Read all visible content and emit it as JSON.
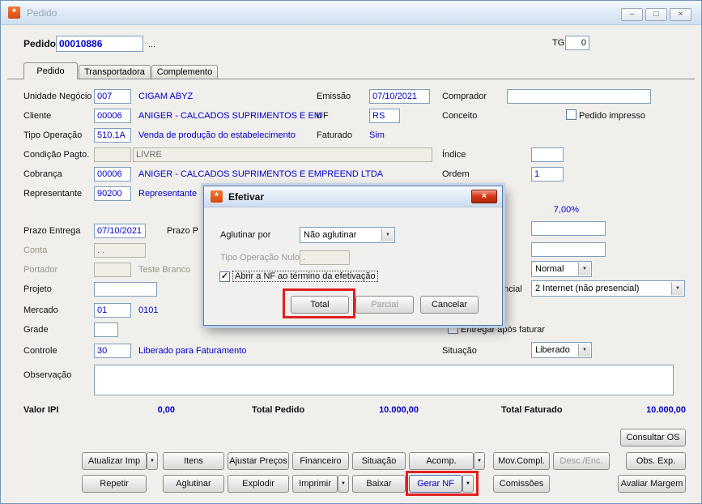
{
  "window": {
    "title": "Pedido"
  },
  "icons": {
    "app": "*",
    "close": "×",
    "minimize": "–",
    "maximize": "□",
    "dropdown": "▼",
    "check": "✓"
  },
  "header": {
    "pedido_label": "Pedido",
    "pedido_value": "00010886",
    "more_button": "...",
    "tg_label": "TG",
    "tg_value": "0"
  },
  "tabs": {
    "pedido": "Pedido",
    "transportadora": "Transportadora",
    "complemento": "Complemento"
  },
  "form": {
    "unidade_negocio": {
      "label": "Unidade Negócio",
      "code": "007",
      "desc": "CIGAM ABYZ"
    },
    "emissao": {
      "label": "Emissão",
      "value": "07/10/2021"
    },
    "comprador": {
      "label": "Comprador",
      "value": ""
    },
    "cliente": {
      "label": "Cliente",
      "code": "00006",
      "desc": "ANIGER - CALCADOS SUPRIMENTOS E EM"
    },
    "uf": {
      "label": "UF",
      "value": "RS"
    },
    "conceito": {
      "label": "Conceito"
    },
    "pedido_impresso": {
      "label": "Pedido impresso",
      "checked": false
    },
    "tipo_operacao": {
      "label": "Tipo Operação",
      "code": "510.1A",
      "desc": "Venda de produção do estabelecimento"
    },
    "faturado": {
      "label": "Faturado",
      "value": "Sim"
    },
    "condicao_pagto": {
      "label": "Condição Pagto.",
      "code": "",
      "value": "LIVRE"
    },
    "indice": {
      "label": "Índice",
      "value": ""
    },
    "cobranca": {
      "label": "Cobrança",
      "code": "00006",
      "desc": "ANIGER - CALCADOS SUPRIMENTOS E EMPREEND LTDA"
    },
    "ordem": {
      "label": "Ordem",
      "value": "1"
    },
    "representante": {
      "label": "Representante",
      "code": "90200",
      "desc": "Representante"
    },
    "percentual": {
      "value": "7,00%"
    },
    "campo_extra1": {
      "value": ""
    },
    "campo_extra2": {
      "value": ""
    },
    "prazo_entrega": {
      "label": "Prazo Entrega",
      "value": "07/10/2021"
    },
    "prazo_p": {
      "label": "Prazo P"
    },
    "conta": {
      "label": "Conta",
      "value": ". ."
    },
    "portador": {
      "label": "Portador",
      "code": "",
      "desc": "Teste Branco"
    },
    "tipo_frete": {
      "value": "Normal"
    },
    "projeto": {
      "label": "Projeto",
      "value": ""
    },
    "presencial": {
      "label_visible": "encial",
      "value": "2 Internet (não presencial)"
    },
    "mercado": {
      "label": "Mercado",
      "code": "01",
      "desc": "0101"
    },
    "grade": {
      "label": "Grade",
      "value": ""
    },
    "entregar_apos_faturar": {
      "label": "Entregar após faturar",
      "checked": false
    },
    "controle": {
      "label": "Controle",
      "code": "30",
      "desc": "Liberado para Faturamento"
    },
    "situacao": {
      "label": "Situação",
      "value": "Liberado"
    },
    "observacao": {
      "label": "Observação",
      "value": ""
    }
  },
  "totals": {
    "valor_ipi_label": "Valor IPI",
    "valor_ipi_value": "0,00",
    "total_pedido_label": "Total Pedido",
    "total_pedido_value": "10.000,00",
    "total_faturado_label": "Total Faturado",
    "total_faturado_value": "10.000,00"
  },
  "actions": {
    "consultar_os": "Consultar OS",
    "atualizar_imp": "Atualizar Imp",
    "itens": "Itens",
    "ajustar_precos": "Ajustar Preços",
    "financeiro": "Financeiro",
    "situacao": "Situação",
    "acomp": "Acomp.",
    "mov_compl": "Mov.Compl.",
    "desc_enc": "Desc./Enc.",
    "obs_exp": "Obs. Exp.",
    "repetir": "Repetir",
    "aglutinar": "Aglutinar",
    "explodir": "Explodir",
    "imprimir": "Imprimir",
    "baixar": "Baixar",
    "gerar_nf": "Gerar NF",
    "comissoes": "Comissões",
    "avaliar_margem": "Avaliar Margem"
  },
  "dialog": {
    "title": "Efetivar",
    "aglutinar_por_label": "Aglutinar por",
    "aglutinar_por_value": "Não aglutinar",
    "tipo_operacao_nulo_label": "Tipo Operação Nulo",
    "tipo_operacao_nulo_value": ".",
    "abrir_nf_label": "Abrir a NF ao término da efetivação",
    "abrir_nf_checked": true,
    "total": "Total",
    "parcial": "Parcial",
    "cancelar": "Cancelar"
  }
}
